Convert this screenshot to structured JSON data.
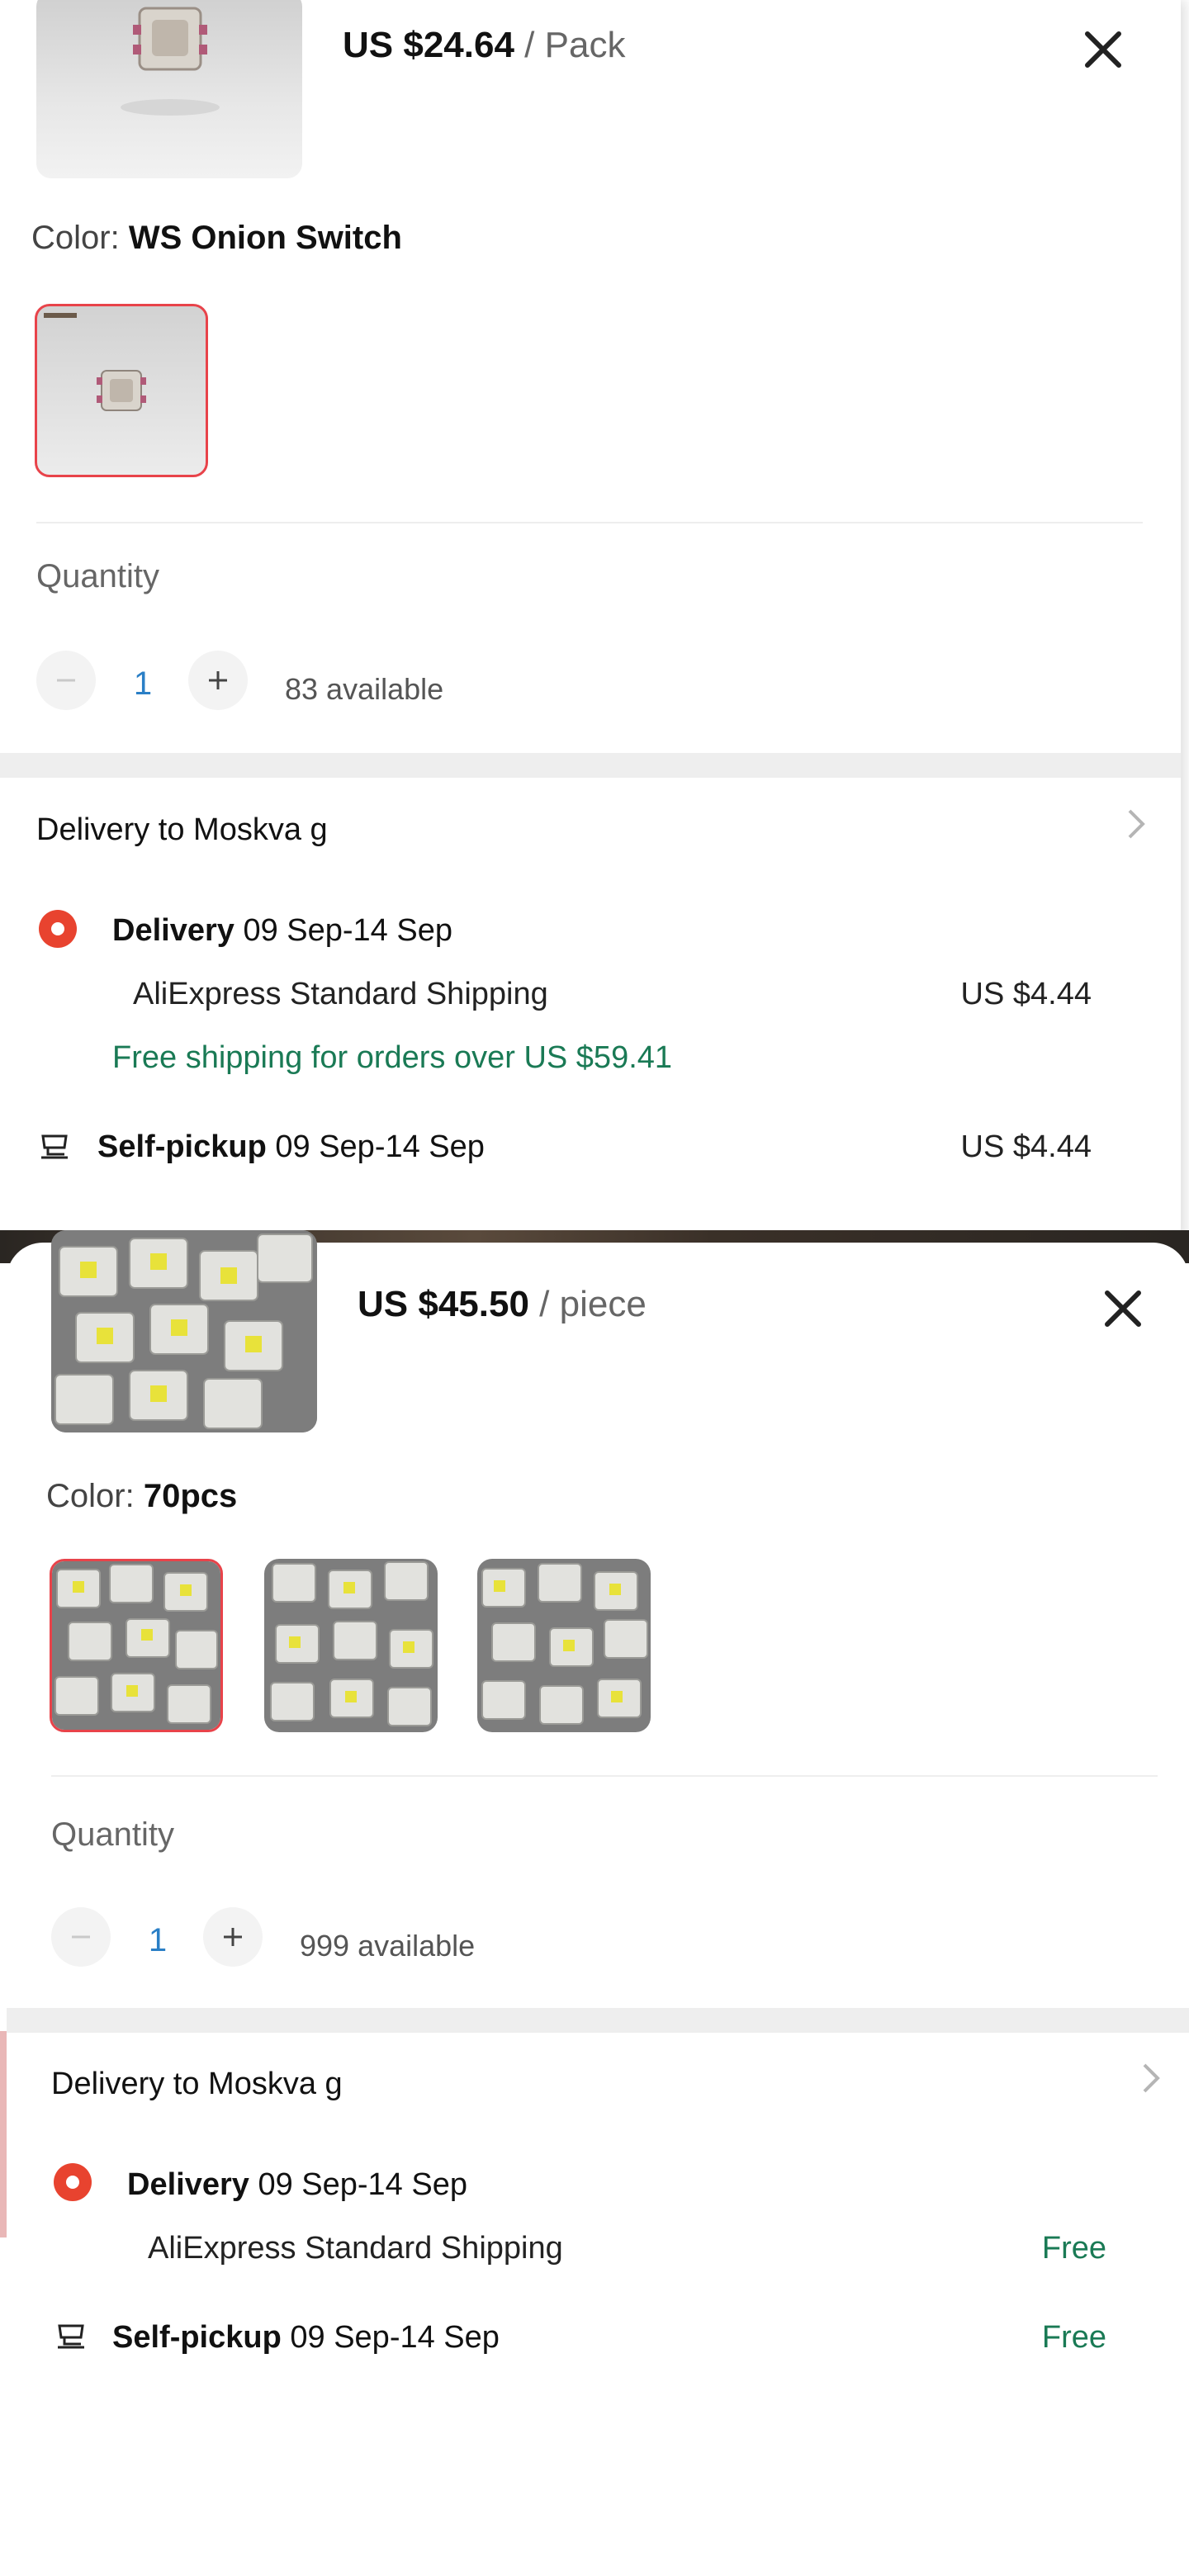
{
  "sheet1": {
    "price": "US $24.64",
    "unit": "/ Pack",
    "color_label": "Color:",
    "color_value": "WS Onion Switch",
    "quantity_label": "Quantity",
    "quantity_value": "1",
    "available": "83 available",
    "delivery_to": "Delivery to Moskva g",
    "delivery_label": "Delivery",
    "delivery_dates": "09 Sep-14 Sep",
    "shipping_method": "AliExpress Standard Shipping",
    "shipping_cost": "US $4.44",
    "free_shipping_note": "Free shipping for orders over US $59.41",
    "pickup_label": "Self-pickup",
    "pickup_dates": "09 Sep-14 Sep",
    "pickup_cost": "US $4.44"
  },
  "sheet2": {
    "price": "US $45.50",
    "unit": "/ piece",
    "color_label": "Color:",
    "color_value": "70pcs",
    "quantity_label": "Quantity",
    "quantity_value": "1",
    "available": "999 available",
    "delivery_to": "Delivery to Moskva g",
    "delivery_label": "Delivery",
    "delivery_dates": "09 Sep-14 Sep",
    "shipping_method": "AliExpress Standard Shipping",
    "shipping_cost": "Free",
    "pickup_label": "Self-pickup",
    "pickup_dates": "09 Sep-14 Sep",
    "pickup_cost": "Free"
  },
  "colors": {
    "accent_red": "#e8434a",
    "free_green": "#1a7a55",
    "qty_blue": "#2a7fc6"
  }
}
